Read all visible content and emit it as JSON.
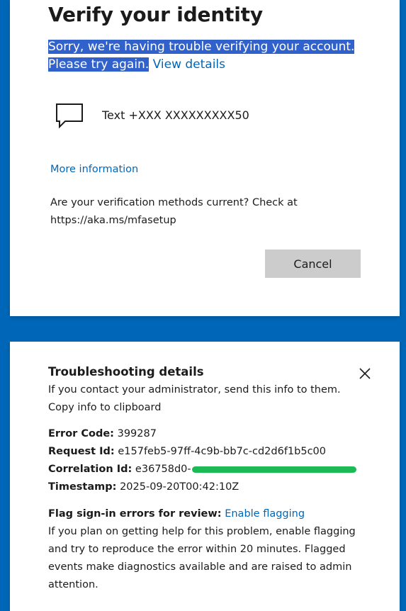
{
  "verify": {
    "title": "Verify your identity",
    "error_line1": "Sorry, we're having trouble verifying your account.",
    "error_line2": "Please try again.",
    "view_details": "View details",
    "method_label": "Text +XXX XXXXXXXXX50",
    "more_information": "More information",
    "methods_current": "Are your verification methods current? Check at https://aka.ms/mfasetup",
    "cancel_label": "Cancel"
  },
  "troubleshooting": {
    "title": "Troubleshooting details",
    "contact_text": "If you contact your administrator, send this info to them.",
    "copy_link": "Copy info to clipboard",
    "error_code_label": "Error Code:",
    "error_code": "399287",
    "request_id_label": "Request Id:",
    "request_id": "e157feb5-97ff-4c9b-bb7c-cd2d6f1b5c00",
    "correlation_id_label": "Correlation Id:",
    "correlation_id": "e36758d0-",
    "timestamp_label": "Timestamp:",
    "timestamp": "2025-09-20T00:42:10Z",
    "flag_label": "Flag sign-in errors for review:",
    "enable_flagging": "Enable flagging",
    "plan_text": "If you plan on getting help for this problem, enable flagging and try to reproduce the error within 20 minutes. Flagged events make diagnostics available and are raised to admin attention."
  },
  "colors": {
    "background": "#0067b8",
    "link": "#0067b8",
    "selection": "#3162cc",
    "redaction": "#1db954",
    "button": "#cccccc"
  },
  "icons": {
    "method": "chat-bubble-icon",
    "close": "close-icon"
  }
}
